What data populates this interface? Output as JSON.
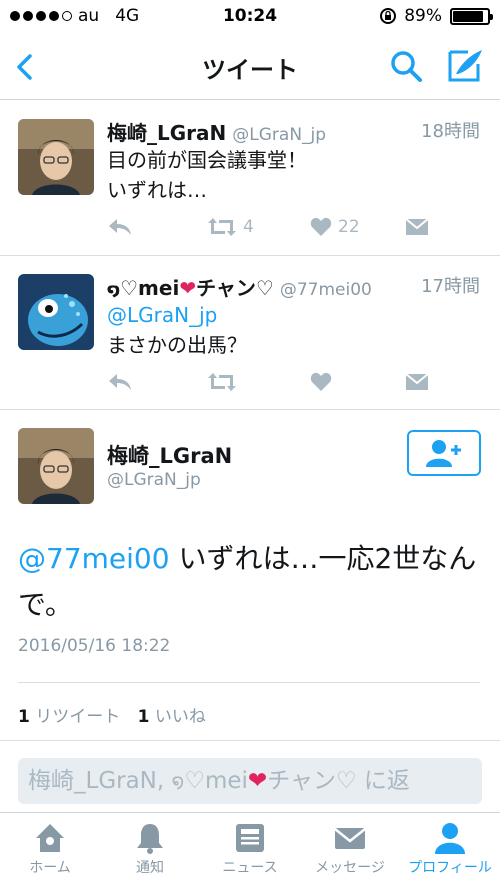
{
  "status_bar": {
    "carrier": "au",
    "network": "4G",
    "time": "10:24",
    "battery": "89%",
    "battery_level": 0.89
  },
  "nav": {
    "title": "ツイート"
  },
  "tweets": [
    {
      "name": "梅崎_LGraN",
      "handle": "@LGraN_jp",
      "time": "18時間",
      "text_line1": "目の前が国会議事堂！",
      "text_line2": "いずれは…",
      "retweets": "4",
      "likes": "22"
    },
    {
      "name_prefix": "♡mei",
      "name_suffix": "チャン♡",
      "handle": "@77mei00",
      "time": "17時間",
      "mention": "@LGraN_jp",
      "text": "まさかの出馬？"
    }
  ],
  "focus": {
    "name": "梅崎_LGraN",
    "handle": "@LGraN_jp",
    "mention": "@77mei00",
    "text": " いずれは…一応2世なんで。",
    "date": "2016/05/16 18:22",
    "retweet_count": "1",
    "retweet_label": "リツイート",
    "like_count": "1",
    "like_label": "いいね"
  },
  "reply": {
    "placeholder_start": "梅崎_LGraN, ",
    "placeholder_mid": "♡mei",
    "placeholder_end": "チャン♡ に返"
  },
  "tabs": [
    {
      "label": "ホーム",
      "icon": "home-icon"
    },
    {
      "label": "通知",
      "icon": "bell-icon"
    },
    {
      "label": "ニュース",
      "icon": "news-icon"
    },
    {
      "label": "メッセージ",
      "icon": "mail-icon"
    },
    {
      "label": "プロフィール",
      "icon": "profile-icon"
    }
  ],
  "colors": {
    "accent": "#1da1f2",
    "muted": "#8899a6",
    "heart": "#e0245e"
  }
}
